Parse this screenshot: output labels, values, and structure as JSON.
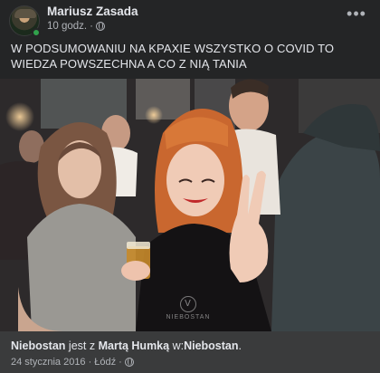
{
  "post": {
    "author": "Mariusz Zasada",
    "time": "10 godz.",
    "separator": "·",
    "text": "W PODSUMOWANIU NA KPAXIE WSZYSTKO O COVID TO WIEDZA POWSZECHNA A CO Z NIĄ TANIA",
    "more_label": "•••"
  },
  "photo": {
    "watermark_text": "NIEBOSTAN"
  },
  "attachment": {
    "page": "Niebostan",
    "is_with": "jest z",
    "tagged_person": "Martą Humką",
    "at_word": "w:",
    "place": "Niebostan",
    "period": ".",
    "date": "24 stycznia 2016",
    "sep": "·",
    "location": "Łódź",
    "sep2": "·"
  },
  "colors": {
    "background": "#242526",
    "attachment_bg": "#3a3b3c",
    "primary_text": "#e4e6eb",
    "secondary_text": "#b0b3b8",
    "online": "#31a24c"
  },
  "icons": {
    "more": "ellipsis-horizontal-icon",
    "audience": "globe-icon",
    "online": "online-status-dot"
  }
}
